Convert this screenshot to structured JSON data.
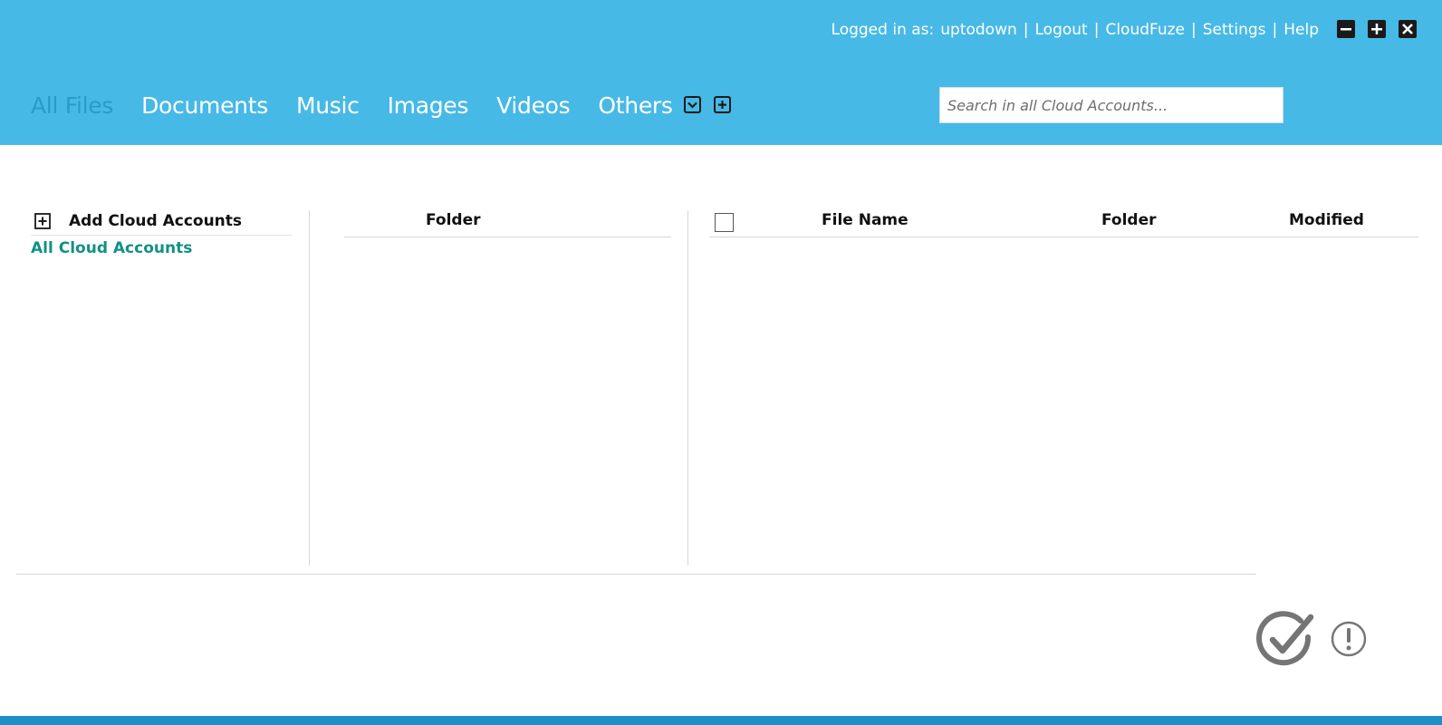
{
  "header": {
    "logged_in_label": "Logged in as:",
    "username": "uptodown",
    "links": {
      "logout": "Logout",
      "cloudfuze": "CloudFuze",
      "settings": "Settings",
      "help": "Help"
    },
    "separator": "|"
  },
  "window_controls": {
    "minimize_icon": "minus-icon",
    "maximize_icon": "plus-icon",
    "close_icon": "close-icon"
  },
  "tabs": [
    {
      "label": "All Files",
      "active": true
    },
    {
      "label": "Documents",
      "active": false
    },
    {
      "label": "Music",
      "active": false
    },
    {
      "label": "Images",
      "active": false
    },
    {
      "label": "Videos",
      "active": false
    },
    {
      "label": "Others",
      "active": false
    }
  ],
  "tab_tools": {
    "dropdown_icon": "chevron-down-box-icon",
    "add_icon": "plus-box-icon"
  },
  "search": {
    "value": "",
    "placeholder": "Search in all Cloud Accounts..."
  },
  "accounts_panel": {
    "add_label": "Add Cloud Accounts",
    "all_accounts_label": "All Cloud Accounts"
  },
  "folder_panel": {
    "header": "Folder"
  },
  "files_panel": {
    "columns": {
      "file_name": "File Name",
      "folder": "Folder",
      "modified": "Modified"
    }
  },
  "status": {
    "ok_icon": "check-circle-icon",
    "alert_icon": "exclamation-circle-icon"
  },
  "colors": {
    "header_bg": "#47b9e6",
    "active_tab": "#2a9bc9",
    "accent_green": "#119186",
    "bottom_bar": "#1e8fc7"
  }
}
